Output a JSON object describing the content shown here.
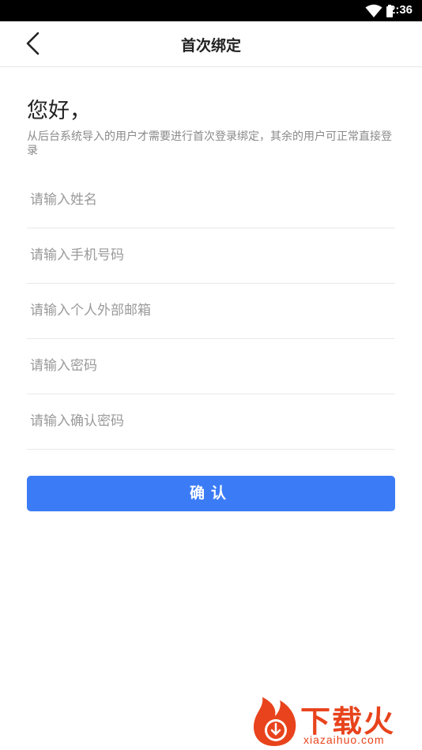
{
  "status_bar": {
    "time": "2:36"
  },
  "header": {
    "title": "首次绑定",
    "back_icon": "chevron-left-icon"
  },
  "main": {
    "greeting": "您好，",
    "description": "从后台系统导入的用户才需要进行首次登录绑定，其余的用户可正常直接登录",
    "fields": [
      {
        "placeholder": "请输入姓名",
        "value": ""
      },
      {
        "placeholder": "请输入手机号码",
        "value": ""
      },
      {
        "placeholder": "请输入个人外部邮箱",
        "value": ""
      },
      {
        "placeholder": "请输入密码",
        "value": ""
      },
      {
        "placeholder": "请输入确认密码",
        "value": ""
      }
    ],
    "confirm_label": "确认"
  },
  "watermark": {
    "brand": "下载火",
    "domain": "xiazaihuo.com"
  },
  "colors": {
    "accent": "#3b7cf6",
    "watermark": "#e8431c"
  }
}
